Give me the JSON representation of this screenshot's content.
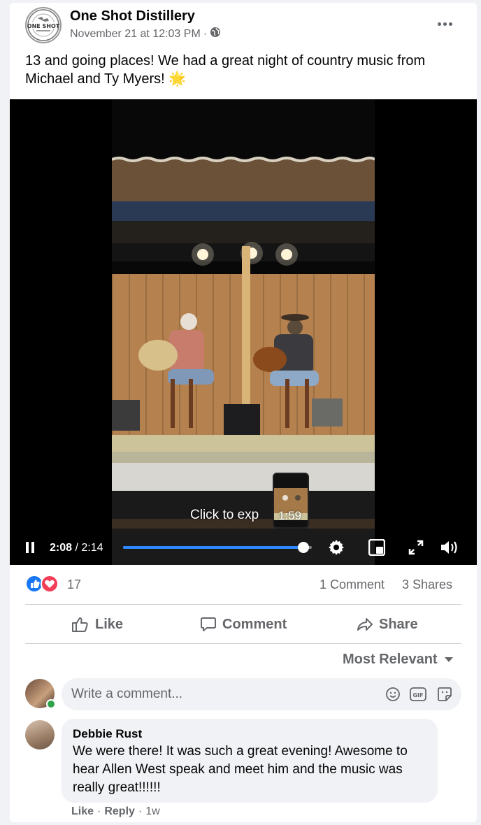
{
  "post": {
    "author": "One Shot Distillery",
    "timestamp": "November 21 at 12:03 PM",
    "separator": "·",
    "audience_icon": "globe-icon",
    "text": "13 and going places! We had a great night of country music from Michael and Ty Myers! 🌟"
  },
  "video": {
    "current_time": "2:08",
    "time_separator": " / ",
    "duration": "2:14",
    "progress": 0.955,
    "hover_tooltip": "Click to exp",
    "hover_time": "1:59",
    "accent": "#2d88ff"
  },
  "stats": {
    "reaction_count": "17",
    "comments": "1 Comment",
    "shares": "3 Shares"
  },
  "actions": {
    "like": "Like",
    "comment": "Comment",
    "share": "Share"
  },
  "sort_label": "Most Relevant",
  "composer": {
    "placeholder": "Write a comment..."
  },
  "comments": [
    {
      "author": "Debbie Rust",
      "text": "We were there! It was such a great evening! Awesome to hear Allen West speak and meet him and the music was really great!!!!!!",
      "like": "Like",
      "reply": "Reply",
      "sep": "·",
      "age": "1w"
    }
  ],
  "colors": {
    "like_blue": "#1877f2",
    "love_red": "#f33e58",
    "secondary_text": "#65676b"
  }
}
